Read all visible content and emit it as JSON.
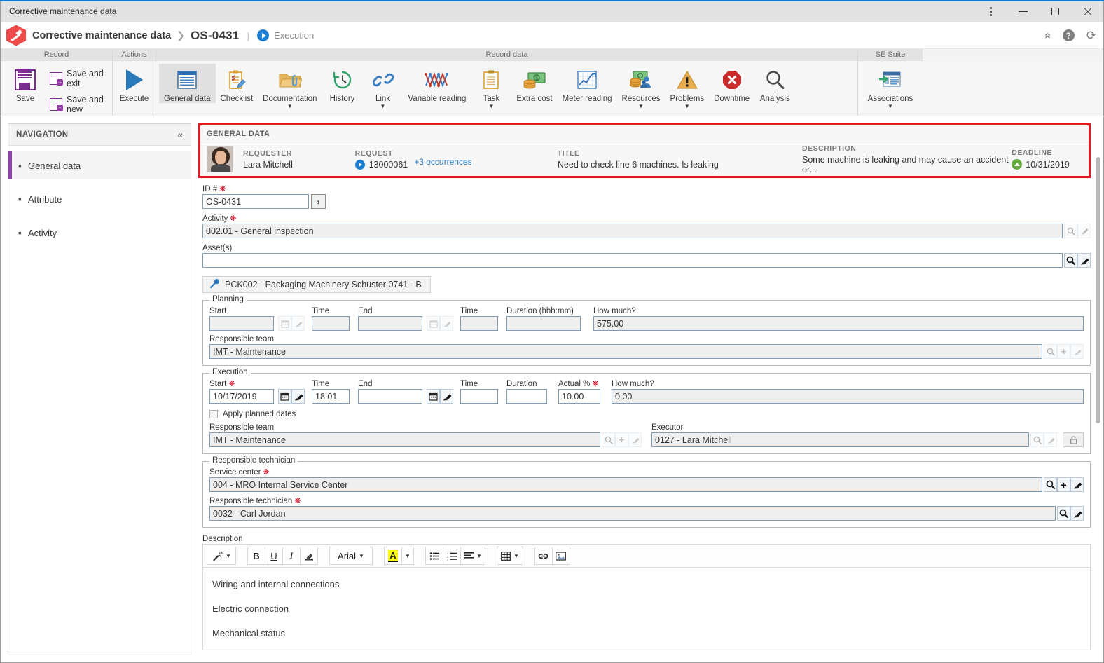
{
  "window": {
    "title": "Corrective maintenance data",
    "controls": {
      "menu": "⋮",
      "minimize": "—",
      "maximize": "☐",
      "close": "✕"
    }
  },
  "breadcrumb": {
    "app": "Corrective maintenance data",
    "separator": "❯",
    "record_id": "OS-0431",
    "pipe": "|",
    "status": "Execution",
    "collapse_icon": "«",
    "help_icon": "?",
    "refresh_icon": "⟳"
  },
  "ribbon": {
    "groups": [
      {
        "title": "Record",
        "buttons": [
          {
            "label": "Save",
            "icon": "floppy-disk-icon",
            "style": "large"
          },
          {
            "label": "Save and exit",
            "icon": "save-exit-icon",
            "style": "inline"
          },
          {
            "label": "Save and new",
            "icon": "save-new-icon",
            "style": "inline"
          }
        ]
      },
      {
        "title": "Actions",
        "buttons": [
          {
            "label": "Execute",
            "icon": "play-triangle-icon",
            "style": "large"
          }
        ]
      },
      {
        "title": "Record data",
        "buttons": [
          {
            "label": "General data",
            "icon": "document-lines-icon",
            "active": true
          },
          {
            "label": "Checklist",
            "icon": "clipboard-pencil-icon"
          },
          {
            "label": "Documentation",
            "icon": "folder-clip-icon",
            "caret": true
          },
          {
            "label": "History",
            "icon": "clock-back-icon"
          },
          {
            "label": "Link",
            "icon": "chain-link-icon",
            "caret": true
          },
          {
            "label": "Variable reading",
            "icon": "zigzag-chart-icon"
          },
          {
            "label": "Task",
            "icon": "clipboard-icon",
            "caret": true
          },
          {
            "label": "Extra cost",
            "icon": "money-coins-icon"
          },
          {
            "label": "Meter reading",
            "icon": "line-chart-icon"
          },
          {
            "label": "Resources",
            "icon": "money-people-icon",
            "caret": true
          },
          {
            "label": "Problems",
            "icon": "warning-triangle-icon",
            "caret": true
          },
          {
            "label": "Downtime",
            "icon": "stop-x-icon"
          },
          {
            "label": "Analysis",
            "icon": "magnifier-icon"
          }
        ]
      },
      {
        "title": "SE Suite",
        "buttons": [
          {
            "label": "Associations",
            "icon": "window-arrow-icon",
            "caret": true
          }
        ]
      }
    ]
  },
  "sidebar": {
    "header": "NAVIGATION",
    "collapse_icon": "«",
    "items": [
      {
        "label": "General data",
        "selected": true
      },
      {
        "label": "Attribute",
        "selected": false
      },
      {
        "label": "Activity",
        "selected": false
      }
    ]
  },
  "general_data_panel": {
    "title": "GENERAL DATA",
    "highlight_color": "#e8161f",
    "requester": {
      "label": "REQUESTER",
      "value": "Lara Mitchell"
    },
    "request": {
      "label": "REQUEST",
      "value": "13000061",
      "occurrences_link": "+3 occurrences"
    },
    "title_field": {
      "label": "TITLE",
      "value": "Need to check line 6 machines. Is leaking"
    },
    "description": {
      "label": "DESCRIPTION",
      "value": "Some machine is leaking and may cause an accident or..."
    },
    "deadline": {
      "label": "DEADLINE",
      "value": "10/31/2019"
    }
  },
  "form": {
    "id_number": {
      "label": "ID #",
      "required": true,
      "value": "OS-0431",
      "go_button": "›"
    },
    "activity": {
      "label": "Activity",
      "required": true,
      "value": "002.01 - General inspection"
    },
    "assets": {
      "label": "Asset(s)",
      "required": false,
      "value": ""
    },
    "asset_chip": {
      "label": "PCK002 - Packaging Machinery Schuster 0741 - B",
      "icon": "wrench-icon"
    },
    "planning": {
      "legend": "Planning",
      "start": {
        "label": "Start",
        "value": ""
      },
      "start_time": {
        "label": "Time",
        "value": ""
      },
      "end": {
        "label": "End",
        "value": ""
      },
      "end_time": {
        "label": "Time",
        "value": ""
      },
      "duration": {
        "label": "Duration (hhh:mm)",
        "value": ""
      },
      "how_much": {
        "label": "How much?",
        "value": "575.00"
      },
      "responsible_team": {
        "label": "Responsible team",
        "value": "IMT - Maintenance"
      }
    },
    "execution": {
      "legend": "Execution",
      "start": {
        "label": "Start",
        "required": true,
        "value": "10/17/2019"
      },
      "start_time": {
        "label": "Time",
        "value": "18:01"
      },
      "end": {
        "label": "End",
        "value": ""
      },
      "end_time": {
        "label": "Time",
        "value": ""
      },
      "duration": {
        "label": "Duration",
        "value": ""
      },
      "actual_pct": {
        "label": "Actual %",
        "required": true,
        "value": "10.00"
      },
      "how_much": {
        "label": "How much?",
        "value": "0.00"
      },
      "apply_planned_dates": {
        "label": "Apply planned dates",
        "checked": false
      },
      "responsible_team": {
        "label": "Responsible team",
        "value": "IMT - Maintenance"
      },
      "executor": {
        "label": "Executor",
        "value": "0127 - Lara Mitchell"
      }
    },
    "responsible_technician": {
      "legend": "Responsible technician",
      "service_center": {
        "label": "Service center",
        "required": true,
        "value": "004 - MRO Internal Service Center"
      },
      "technician": {
        "label": "Responsible technician",
        "required": true,
        "value": "0032 - Carl Jordan"
      }
    },
    "description_editor": {
      "label": "Description",
      "toolbar": [
        {
          "name": "format-wand",
          "glyph": "✨",
          "caret": true
        },
        {
          "name": "bold",
          "glyph": "B"
        },
        {
          "name": "underline",
          "glyph": "U"
        },
        {
          "name": "italic",
          "glyph": "I"
        },
        {
          "name": "eraser",
          "glyph": "▮"
        },
        {
          "name": "font-family",
          "glyph": "Arial",
          "caret": true
        },
        {
          "name": "text-color",
          "glyph": "A"
        },
        {
          "name": "text-color-dropdown",
          "glyph": "",
          "caret": true
        },
        {
          "name": "bullet-list",
          "glyph": "☰"
        },
        {
          "name": "numbered-list",
          "glyph": "≡"
        },
        {
          "name": "align",
          "glyph": "≡",
          "caret": true
        },
        {
          "name": "table",
          "glyph": "▦",
          "caret": true
        },
        {
          "name": "link",
          "glyph": "⚭"
        },
        {
          "name": "image",
          "glyph": "Ὓc"
        }
      ],
      "content_lines": [
        "Wiring and internal connections",
        "Electric connection",
        "Mechanical status"
      ]
    },
    "field_icons": {
      "search": "search-icon",
      "add": "plus-icon",
      "clear": "brush-icon",
      "calendar": "calendar-icon",
      "lock": "lock-icon"
    }
  }
}
